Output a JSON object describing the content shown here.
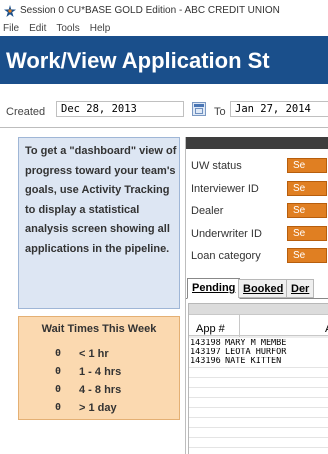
{
  "window": {
    "title": "Session 0 CU*BASE GOLD Edition - ABC CREDIT UNION"
  },
  "menu": [
    "File",
    "Edit",
    "Tools",
    "Help"
  ],
  "header": {
    "title": "Work/View Application St"
  },
  "date_filter": {
    "created_label": "Created",
    "from_value": "Dec 28, 2013",
    "to_label": "To",
    "to_value": "Jan 27, 2014"
  },
  "dashboard_tip": {
    "text": "To get a \"dashboard\" view of progress toward your team's goals, use Activity Tracking to display a statistical analysis screen showing all applications in the pipeline."
  },
  "wait_times": {
    "title": "Wait Times This Week",
    "rows": [
      {
        "count": "0",
        "range": "< 1 hr"
      },
      {
        "count": "0",
        "range": "1 - 4 hrs"
      },
      {
        "count": "0",
        "range": "4 - 8 hrs"
      },
      {
        "count": "0",
        "range": "> 1 day"
      }
    ]
  },
  "filters": [
    {
      "label": "UW status",
      "button": "Se"
    },
    {
      "label": "Interviewer ID",
      "button": "Se"
    },
    {
      "label": "Dealer",
      "button": "Se"
    },
    {
      "label": "Underwriter ID",
      "button": "Se"
    },
    {
      "label": "Loan category",
      "button": "Se"
    }
  ],
  "tabs": [
    "Pending",
    "Booked",
    "Der"
  ],
  "grid": {
    "columns": [
      "App #",
      "A"
    ],
    "rows": [
      {
        "app": "143198",
        "name": "MARY M MEMBE"
      },
      {
        "app": "143197",
        "name": "LEOTA HURFOR"
      },
      {
        "app": "143196",
        "name": "NATE KITTEN"
      }
    ]
  },
  "colors": {
    "header_band": "#1a4f8b",
    "dashboard_panel": "#dde6f3",
    "wait_panel": "#fbd9b0",
    "select_button": "#e07f22"
  }
}
